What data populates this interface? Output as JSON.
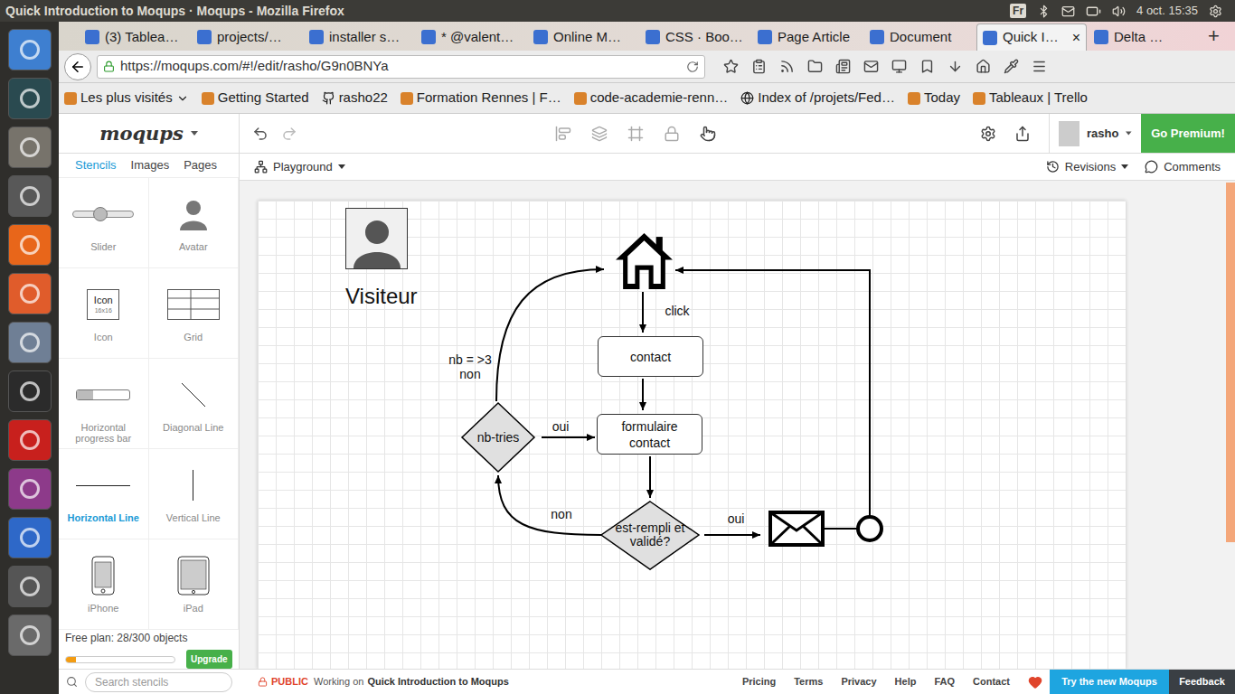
{
  "os_bar": {
    "title": "Quick Introduction to Moqups · Moqups - Mozilla Firefox",
    "keyboard": "Fr",
    "clock": "4 oct. 15:35"
  },
  "browser": {
    "tabs": [
      {
        "label": "(3) Tablea…",
        "selected": false
      },
      {
        "label": "projects/…",
        "selected": false
      },
      {
        "label": "installer s…",
        "selected": false
      },
      {
        "label": "* @valent…",
        "selected": false
      },
      {
        "label": "Online M…",
        "selected": false
      },
      {
        "label": "CSS · Boo…",
        "selected": false
      },
      {
        "label": "Page Article",
        "selected": false
      },
      {
        "label": "Document",
        "selected": false
      },
      {
        "label": "Quick I…",
        "selected": true
      },
      {
        "label": "Delta …",
        "selected": false
      }
    ],
    "close_label": "×",
    "new_tab_label": "+",
    "url": "https://moqups.com/#!/edit/rasho/G9n0BNYa",
    "bookmarks": [
      "Les plus visités",
      "Getting Started",
      "rasho22",
      "Formation Rennes | F…",
      "code-academie-renn…",
      "Index of /projets/Fed…",
      "Today",
      "Tableaux | Trello"
    ]
  },
  "app": {
    "logo": "moqups",
    "user": "rasho",
    "premium": "Go Premium!",
    "project": "Playground",
    "revisions": "Revisions",
    "comments": "Comments",
    "panel_tabs": [
      {
        "label": "Stencils",
        "selected": true
      },
      {
        "label": "Images",
        "selected": false
      },
      {
        "label": "Pages",
        "selected": false
      }
    ],
    "stencils": [
      {
        "label": "Slider",
        "kind": "slider",
        "selected": false,
        "level": 0.45
      },
      {
        "label": "Avatar",
        "kind": "avatar",
        "selected": false
      },
      {
        "label": "Icon",
        "kind": "icon",
        "selected": false,
        "preview": [
          "Icon",
          "16x16"
        ]
      },
      {
        "label": "Grid",
        "kind": "grid",
        "selected": false
      },
      {
        "label": "Horizontal progress bar",
        "kind": "progress",
        "selected": false,
        "level": 0.3
      },
      {
        "label": "Diagonal Line",
        "kind": "diagonal",
        "selected": false
      },
      {
        "label": "Horizontal Line",
        "kind": "hline",
        "selected": true
      },
      {
        "label": "Vertical Line",
        "kind": "vline",
        "selected": false
      },
      {
        "label": "iPhone",
        "kind": "iphone",
        "selected": false
      },
      {
        "label": "iPad",
        "kind": "ipad",
        "selected": false
      }
    ],
    "plan": {
      "text": "Free plan: 28/300 objects",
      "level": 0.09,
      "upgrade": "Upgrade"
    },
    "search_placeholder": "Search stencils",
    "footer": {
      "badge": "PUBLIC",
      "working": "Working on",
      "project": "Quick Introduction to Moqups",
      "links": [
        "Pricing",
        "Terms",
        "Privacy",
        "Help",
        "FAQ",
        "Contact"
      ],
      "try": "Try the new Moqups",
      "feedback": "Feedback"
    },
    "diagram": {
      "actor": "Visiteur",
      "boxes": [
        "contact",
        "formulaire contact"
      ],
      "decisions": [
        "nb-tries",
        "est-rempli et validé?"
      ],
      "labels": [
        [
          "click"
        ],
        [
          "nb = >3",
          "non"
        ],
        [
          "oui"
        ],
        [
          "non"
        ],
        [
          "oui"
        ]
      ]
    }
  }
}
